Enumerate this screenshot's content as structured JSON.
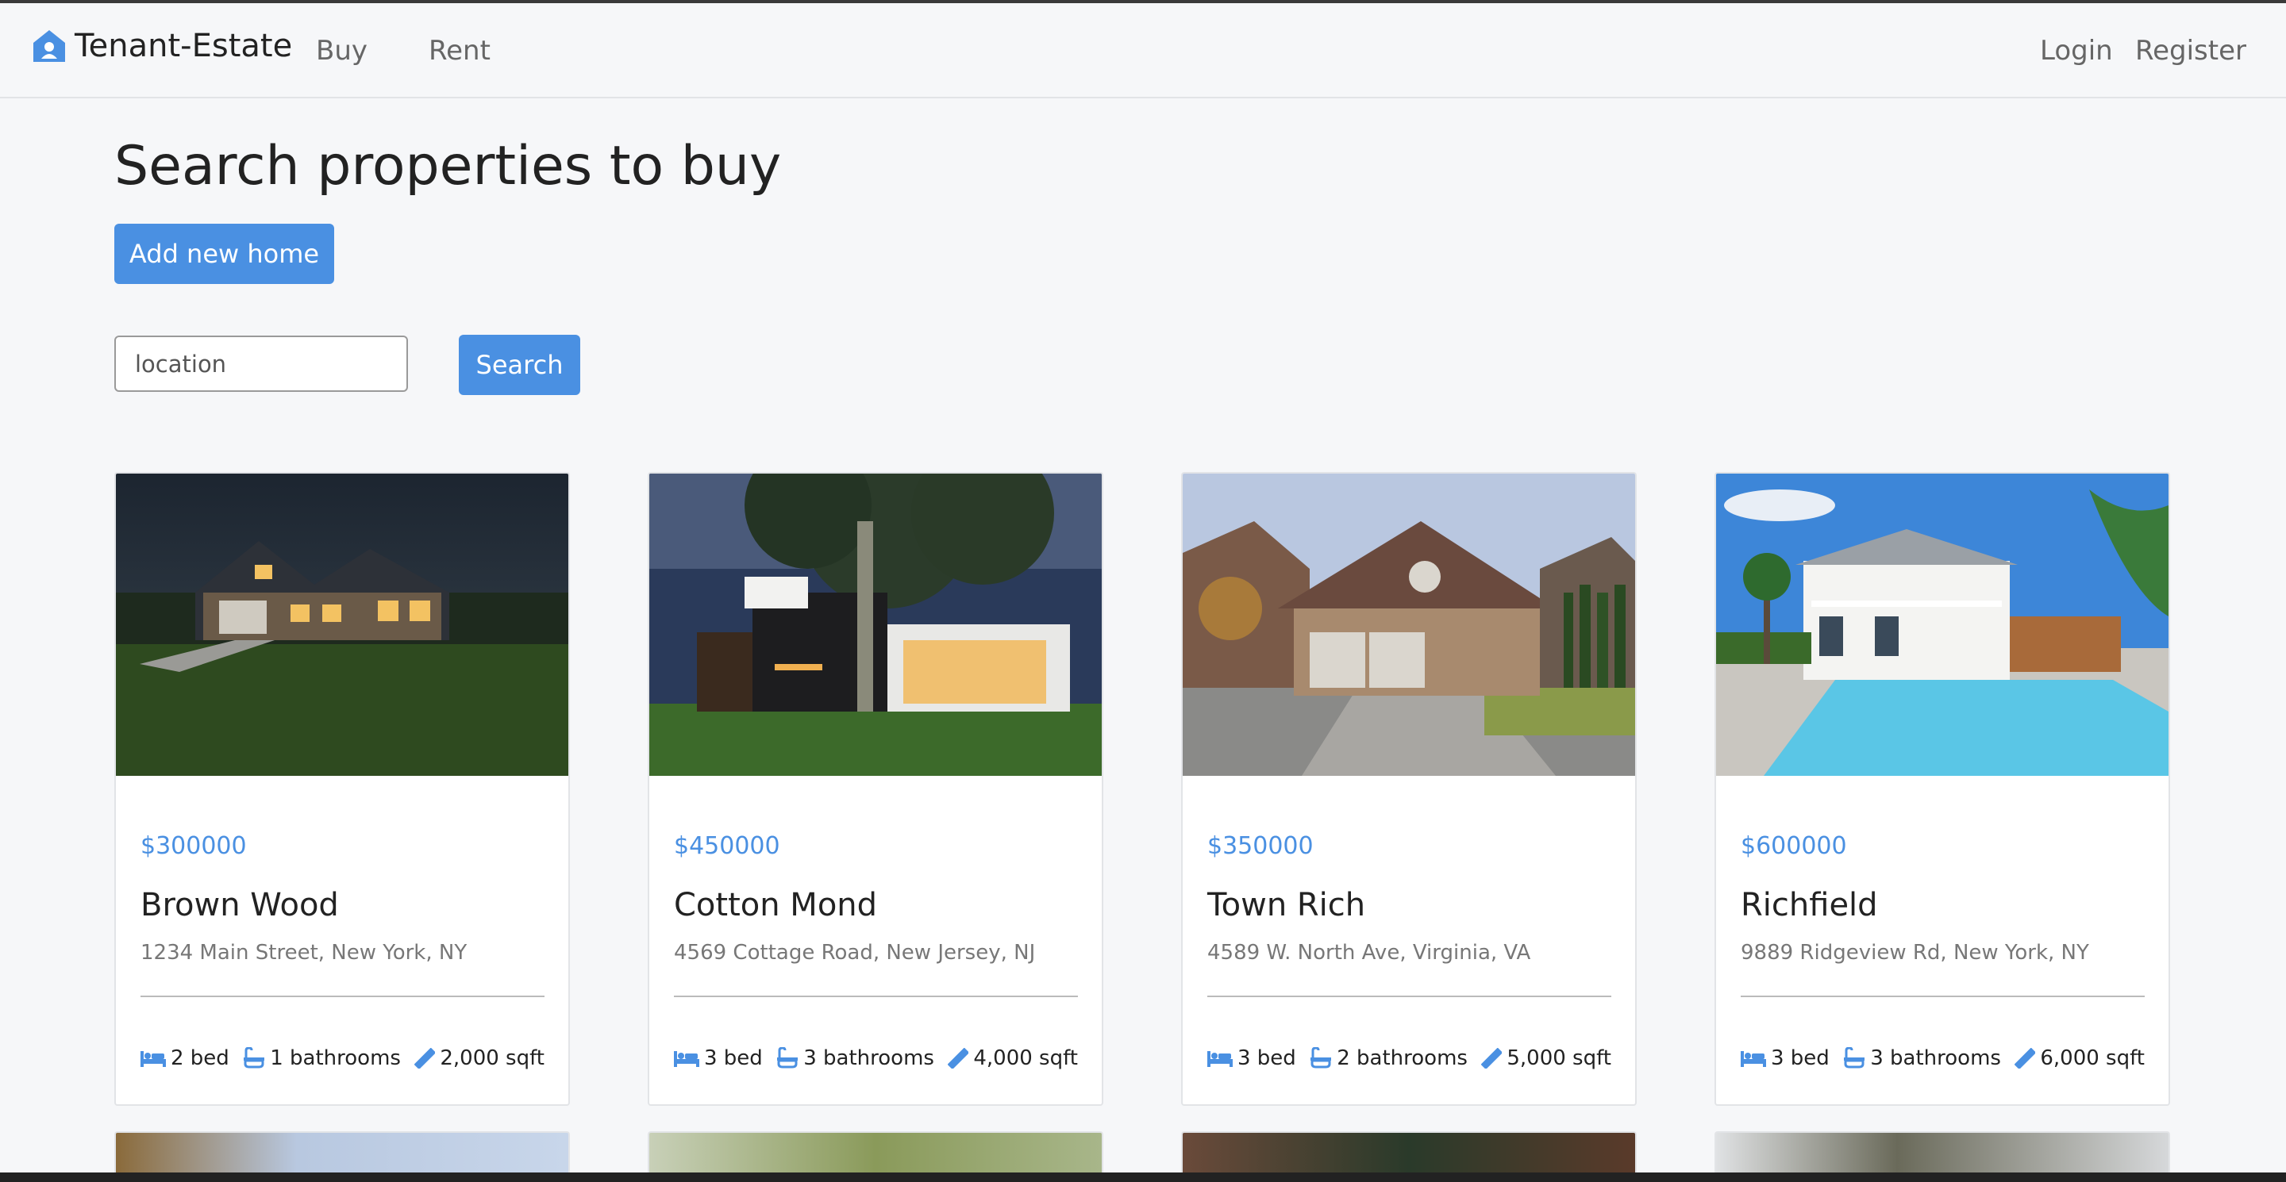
{
  "nav": {
    "brand": "Tenant-Estate",
    "links": {
      "buy": "Buy",
      "rent": "Rent",
      "login": "Login",
      "register": "Register"
    }
  },
  "page": {
    "title": "Search properties to buy",
    "add_button": "Add new home",
    "search": {
      "placeholder": "location",
      "button": "Search"
    }
  },
  "colors": {
    "accent": "#4a90e2",
    "background": "#f6f7f9"
  },
  "listings": [
    {
      "price": "$300000",
      "name": "Brown Wood",
      "address": "1234 Main Street, New York, NY",
      "beds": "2 bed",
      "baths": "1 bathrooms",
      "area": "2,000 sqft"
    },
    {
      "price": "$450000",
      "name": "Cotton Mond",
      "address": "4569 Cottage Road, New Jersey, NJ",
      "beds": "3 bed",
      "baths": "3 bathrooms",
      "area": "4,000 sqft"
    },
    {
      "price": "$350000",
      "name": "Town Rich",
      "address": "4589 W. North Ave, Virginia, VA",
      "beds": "3 bed",
      "baths": "2 bathrooms",
      "area": "5,000 sqft"
    },
    {
      "price": "$600000",
      "name": "Richfield",
      "address": "9889 Ridgeview Rd, New York, NY",
      "beds": "3 bed",
      "baths": "3 bathrooms",
      "area": "6,000 sqft"
    }
  ],
  "icons": {
    "brand": "house-user-icon",
    "bed": "bed-icon",
    "bath": "bath-icon",
    "area": "ruler-icon"
  }
}
